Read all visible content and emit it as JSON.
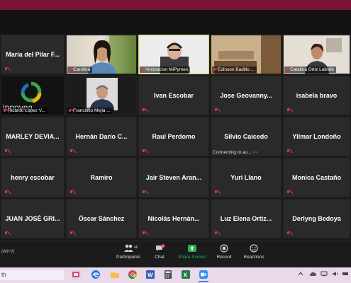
{
  "tiles": [
    {
      "type": "name",
      "name": "Maria del Pilar F..."
    },
    {
      "type": "video",
      "label": "Carolina",
      "scene": "carolina"
    },
    {
      "type": "video",
      "label": "Innovacion MiPymes",
      "scene": "innov",
      "active": true
    },
    {
      "type": "video",
      "label": "Edinson Badillo ...",
      "scene": "edison"
    },
    {
      "type": "video",
      "label": "Catalina Ortiz Lalinde",
      "scene": "catalina"
    },
    {
      "type": "video",
      "label": "Ricardo Lopez V...",
      "scene": "ricardo"
    },
    {
      "type": "video",
      "label": "Francisco Mejia ...",
      "scene": "francisco"
    },
    {
      "type": "name",
      "name": "Ivan Escobar"
    },
    {
      "type": "name",
      "name": "Jose Geovanny..."
    },
    {
      "type": "name",
      "name": "isabela bravo"
    },
    {
      "type": "name",
      "name": "MARLEY DEVIA..."
    },
    {
      "type": "name",
      "name": "Hernán Darío C..."
    },
    {
      "type": "name",
      "name": "Raul Perdomo"
    },
    {
      "type": "name",
      "name": "Silvio Caicedo",
      "status": "Connecting to au..."
    },
    {
      "type": "name",
      "name": "Yilmar Londoño"
    },
    {
      "type": "name",
      "name": "henry escobar"
    },
    {
      "type": "name",
      "name": "Ramiro"
    },
    {
      "type": "name",
      "name": "Jair Steven Aran..."
    },
    {
      "type": "name",
      "name": "Yuri Llano"
    },
    {
      "type": "name",
      "name": "Monica Castaño"
    },
    {
      "type": "name",
      "name": "JUAN JOSÉ GRI..."
    },
    {
      "type": "name",
      "name": "Óscar Sánchez"
    },
    {
      "type": "name",
      "name": "Nicolás Hernán..."
    },
    {
      "type": "name",
      "name": "Luz Elena Ortiz..."
    },
    {
      "type": "name",
      "name": "Derlyng Bedoya"
    }
  ],
  "logo_text": "innovea",
  "toolbar": {
    "shortcut_hint": "(Alt+V)",
    "participants_label": "Participants",
    "participants_count": "46",
    "chat_label": "Chat",
    "chat_badge": "1",
    "share_label": "Share Screen",
    "record_label": "Record",
    "reactions_label": "Reactions"
  },
  "taskbar": {
    "search_text": "th"
  },
  "colors": {
    "accent_green": "#2bb24c",
    "active_border": "#c8d84a",
    "muted_red": "#e23d3d",
    "title_bar": "#7a1336"
  }
}
